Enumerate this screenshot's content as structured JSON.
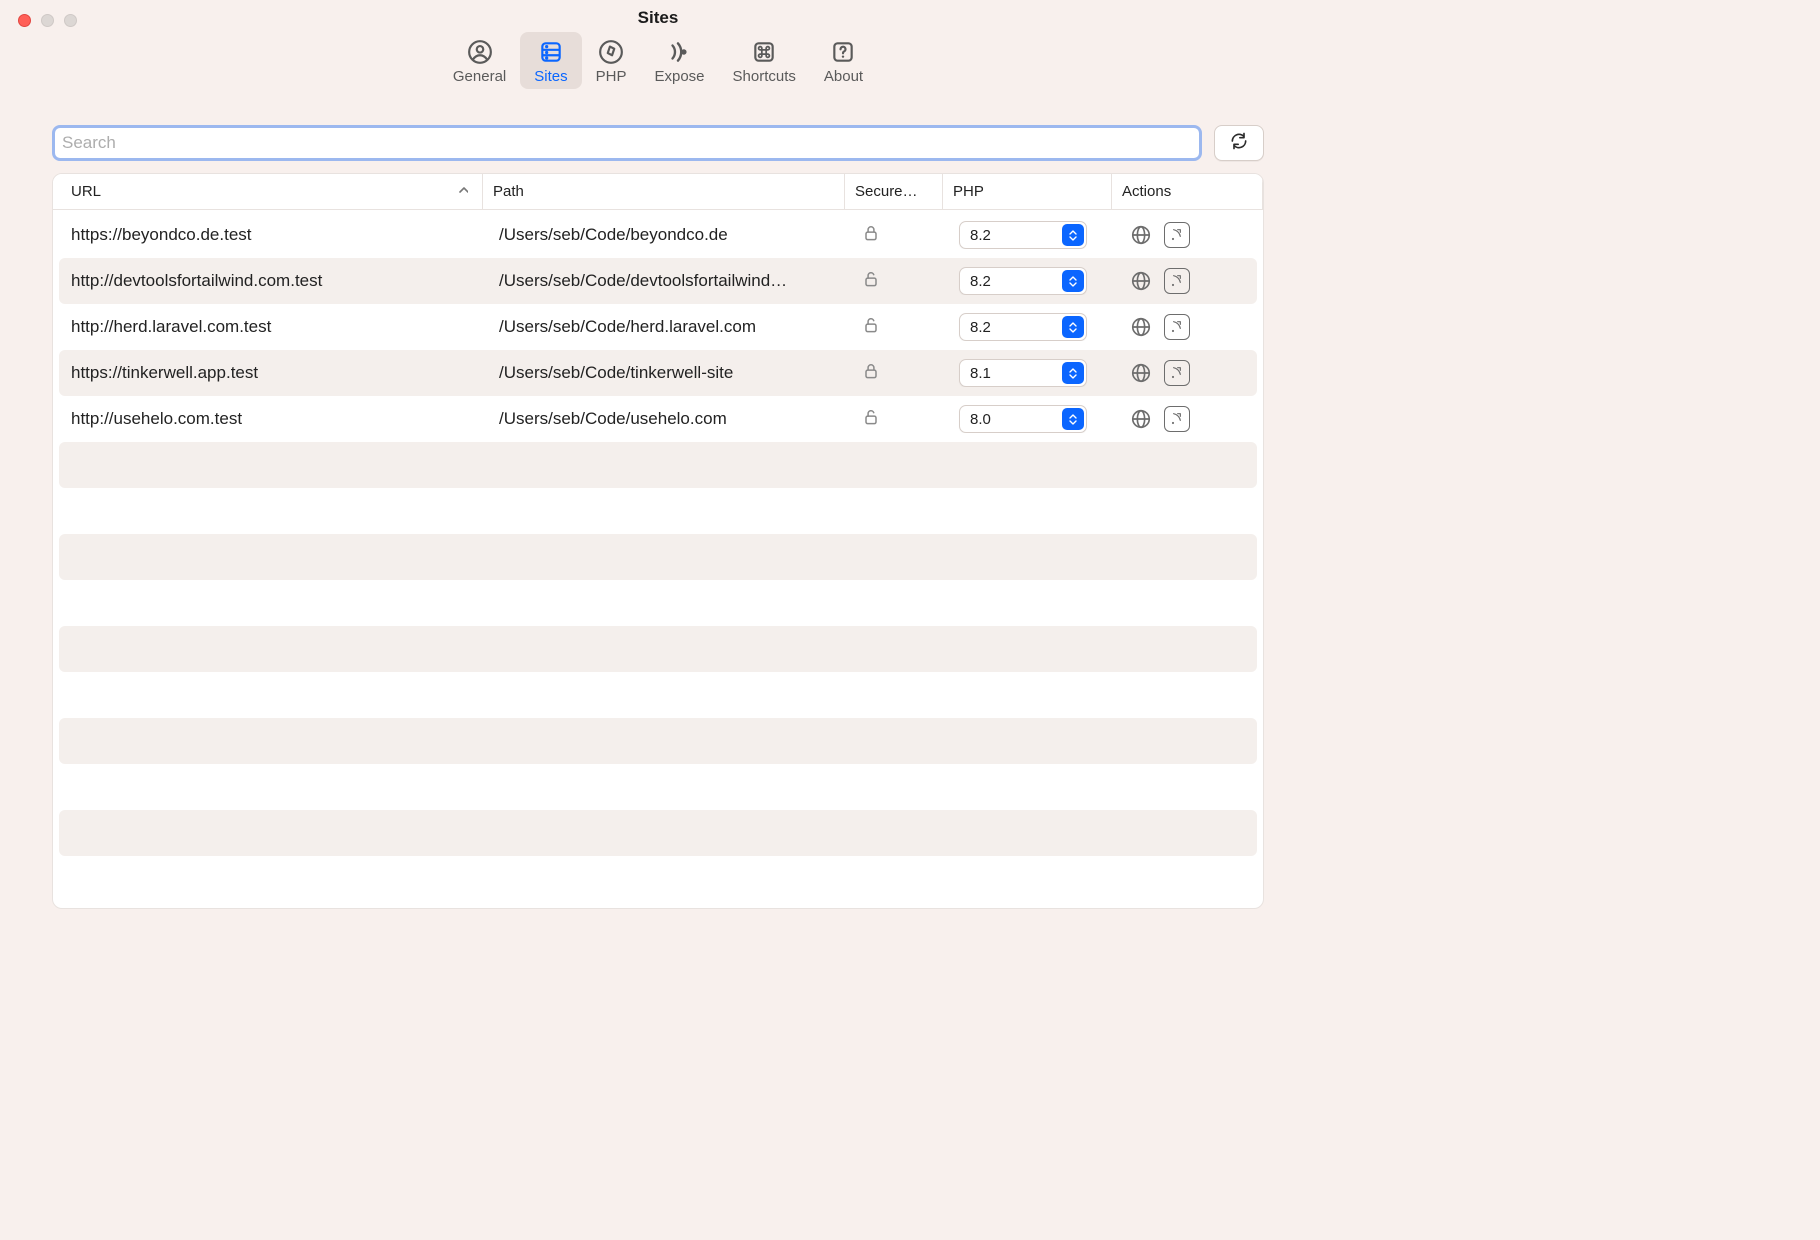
{
  "window_title": "Sites",
  "toolbar": {
    "items": [
      {
        "id": "general",
        "label": "General",
        "icon": "user-circle-icon"
      },
      {
        "id": "sites",
        "label": "Sites",
        "icon": "server-icon",
        "active": true
      },
      {
        "id": "php",
        "label": "PHP",
        "icon": "compass-icon"
      },
      {
        "id": "expose",
        "label": "Expose",
        "icon": "broadcast-icon"
      },
      {
        "id": "shortcuts",
        "label": "Shortcuts",
        "icon": "command-icon"
      },
      {
        "id": "about",
        "label": "About",
        "icon": "question-square-icon"
      }
    ]
  },
  "search": {
    "placeholder": "Search",
    "value": ""
  },
  "columns": {
    "url": "URL",
    "path": "Path",
    "secured": "Secure…",
    "php": "PHP",
    "actions": "Actions"
  },
  "rows": [
    {
      "url": "https://beyondco.de.test",
      "path": "/Users/seb/Code/beyondco.de",
      "secure": true,
      "php": "8.2"
    },
    {
      "url": "http://devtoolsfortailwind.com.test",
      "path": "/Users/seb/Code/devtoolsfortailwind…",
      "secure": false,
      "php": "8.2"
    },
    {
      "url": "http://herd.laravel.com.test",
      "path": "/Users/seb/Code/herd.laravel.com",
      "secure": false,
      "php": "8.2"
    },
    {
      "url": "https://tinkerwell.app.test",
      "path": "/Users/seb/Code/tinkerwell-site",
      "secure": true,
      "php": "8.1"
    },
    {
      "url": "http://usehelo.com.test",
      "path": "/Users/seb/Code/usehelo.com",
      "secure": false,
      "php": "8.0"
    }
  ],
  "empty_stripes": 5
}
